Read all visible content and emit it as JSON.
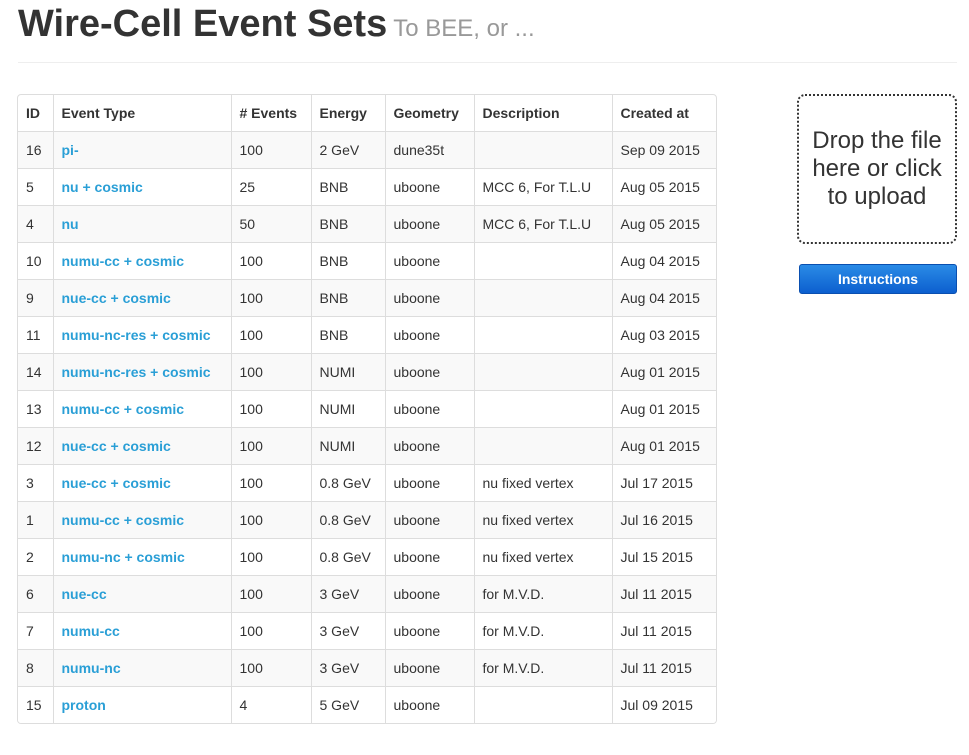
{
  "header": {
    "title": "Wire-Cell Event Sets",
    "subtitle": "To BEE, or ..."
  },
  "table": {
    "columns": [
      "ID",
      "Event Type",
      "# Events",
      "Energy",
      "Geometry",
      "Description",
      "Created at"
    ],
    "rows": [
      {
        "id": "16",
        "type": "pi-",
        "events": "100",
        "energy": "2 GeV",
        "geometry": "dune35t",
        "description": "",
        "created": "Sep 09 2015"
      },
      {
        "id": "5",
        "type": "nu + cosmic",
        "events": "25",
        "energy": "BNB",
        "geometry": "uboone",
        "description": "MCC 6, For T.L.U",
        "created": "Aug 05 2015"
      },
      {
        "id": "4",
        "type": "nu",
        "events": "50",
        "energy": "BNB",
        "geometry": "uboone",
        "description": "MCC 6, For T.L.U",
        "created": "Aug 05 2015"
      },
      {
        "id": "10",
        "type": "numu-cc + cosmic",
        "events": "100",
        "energy": "BNB",
        "geometry": "uboone",
        "description": "",
        "created": "Aug 04 2015"
      },
      {
        "id": "9",
        "type": "nue-cc + cosmic",
        "events": "100",
        "energy": "BNB",
        "geometry": "uboone",
        "description": "",
        "created": "Aug 04 2015"
      },
      {
        "id": "11",
        "type": "numu-nc-res + cosmic",
        "events": "100",
        "energy": "BNB",
        "geometry": "uboone",
        "description": "",
        "created": "Aug 03 2015"
      },
      {
        "id": "14",
        "type": "numu-nc-res + cosmic",
        "events": "100",
        "energy": "NUMI",
        "geometry": "uboone",
        "description": "",
        "created": "Aug 01 2015"
      },
      {
        "id": "13",
        "type": "numu-cc + cosmic",
        "events": "100",
        "energy": "NUMI",
        "geometry": "uboone",
        "description": "",
        "created": "Aug 01 2015"
      },
      {
        "id": "12",
        "type": "nue-cc + cosmic",
        "events": "100",
        "energy": "NUMI",
        "geometry": "uboone",
        "description": "",
        "created": "Aug 01 2015"
      },
      {
        "id": "3",
        "type": "nue-cc + cosmic",
        "events": "100",
        "energy": "0.8 GeV",
        "geometry": "uboone",
        "description": "nu fixed vertex",
        "created": "Jul 17 2015"
      },
      {
        "id": "1",
        "type": "numu-cc + cosmic",
        "events": "100",
        "energy": "0.8 GeV",
        "geometry": "uboone",
        "description": "nu fixed vertex",
        "created": "Jul 16 2015"
      },
      {
        "id": "2",
        "type": "numu-nc + cosmic",
        "events": "100",
        "energy": "0.8 GeV",
        "geometry": "uboone",
        "description": "nu fixed vertex",
        "created": "Jul 15 2015"
      },
      {
        "id": "6",
        "type": "nue-cc",
        "events": "100",
        "energy": "3 GeV",
        "geometry": "uboone",
        "description": "for M.V.D.",
        "created": "Jul 11 2015"
      },
      {
        "id": "7",
        "type": "numu-cc",
        "events": "100",
        "energy": "3 GeV",
        "geometry": "uboone",
        "description": "for M.V.D.",
        "created": "Jul 11 2015"
      },
      {
        "id": "8",
        "type": "numu-nc",
        "events": "100",
        "energy": "3 GeV",
        "geometry": "uboone",
        "description": "for M.V.D.",
        "created": "Jul 11 2015"
      },
      {
        "id": "15",
        "type": "proton",
        "events": "4",
        "energy": "5 GeV",
        "geometry": "uboone",
        "description": "",
        "created": "Jul 09 2015"
      }
    ]
  },
  "upload": {
    "dropzone_text": "Drop the file here or click to upload",
    "instructions_label": "Instructions"
  },
  "colors": {
    "link": "#2a9fd6",
    "button": "#0c5fcf",
    "stripe": "#f9f9f9",
    "border": "#dddddd"
  }
}
